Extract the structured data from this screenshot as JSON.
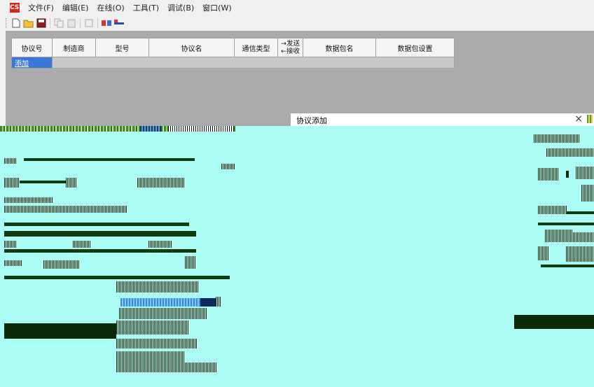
{
  "menu": {
    "logo": "CSY",
    "items": [
      "文件(F)",
      "编辑(E)",
      "在线(O)",
      "工具(T)",
      "调试(B)",
      "窗口(W)"
    ]
  },
  "toolbar": {
    "buttons": [
      "new-icon",
      "open-folder-icon",
      "save-icon",
      "copy-icon",
      "paste-icon",
      "cut-icon",
      "connect-icon",
      "disconnect-icon"
    ]
  },
  "grid": {
    "headers": [
      "协议号",
      "制造商",
      "型号",
      "协议名",
      "通信类型",
      "→发送\n←接收",
      "数据包名",
      "数据包设置"
    ],
    "dir_send": "→发送",
    "dir_recv": "←接收",
    "add_row_label": "添加"
  },
  "dialog": {
    "title": "协议添加",
    "close_glyph": "×"
  },
  "colors": {
    "workspace": "#ababab",
    "dialog_body": "#acfcf6",
    "selection": "#3a78d8"
  }
}
